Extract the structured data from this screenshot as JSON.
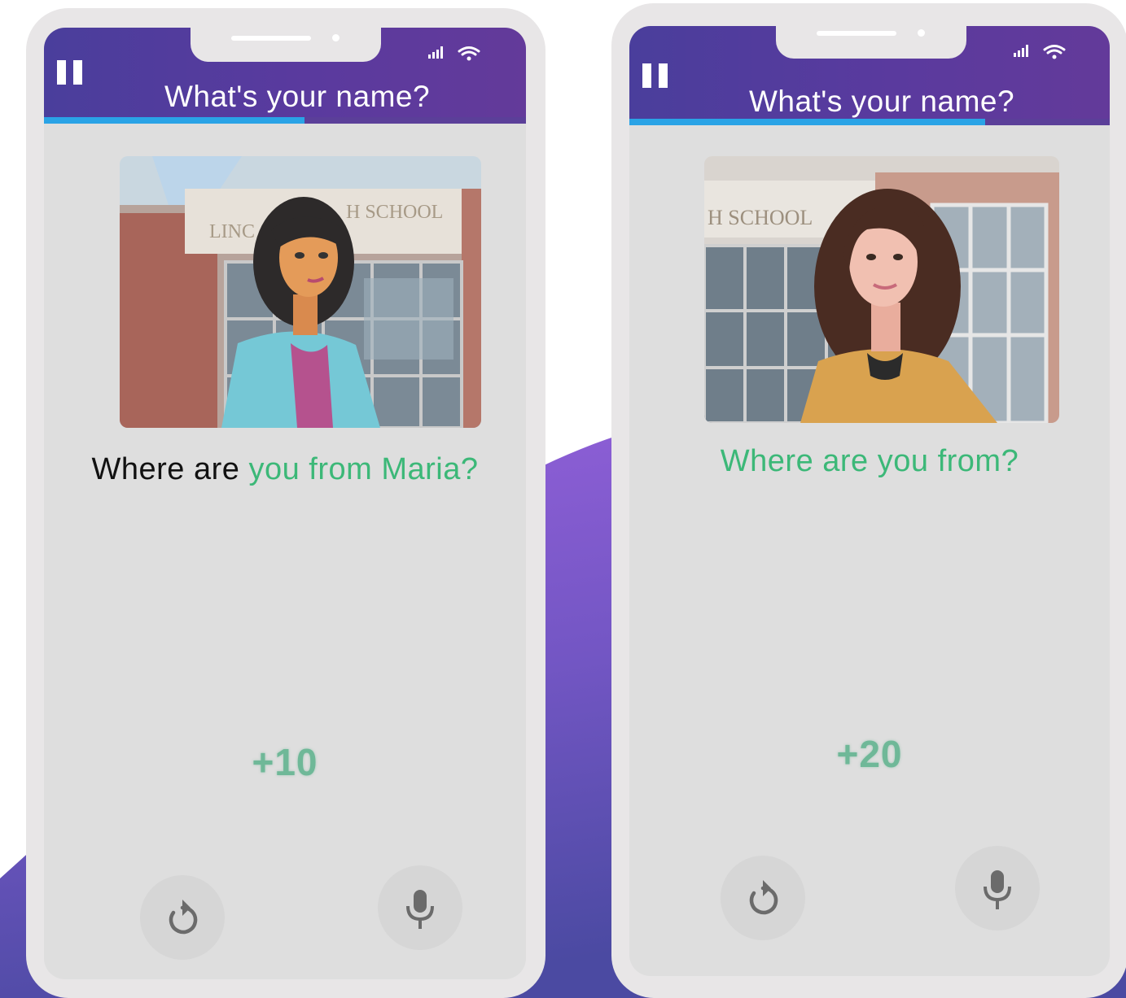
{
  "phones": [
    {
      "header": {
        "title": "What's your name?",
        "progress": 0.54
      },
      "scene": {
        "sign_text": "H SCHOOL",
        "sign_prefix": "LINC"
      },
      "question": {
        "prefix": "Where are ",
        "highlighted": "you from Maria?"
      },
      "points": "+10"
    },
    {
      "header": {
        "title": "What's your name?",
        "progress": 0.74
      },
      "scene": {
        "sign_text": "H SCHOOL"
      },
      "question": {
        "prefix": "",
        "highlighted": "Where are you from?"
      },
      "points": "+20"
    }
  ],
  "colors": {
    "header": "#523c9c",
    "progress": "#2aa3e6",
    "highlight": "#3cb878",
    "points": "#6fb898",
    "background_accent": "#8d5fd6"
  },
  "icons": [
    "pause-icon",
    "signal-icon",
    "wifi-icon",
    "replay-icon",
    "microphone-icon"
  ]
}
